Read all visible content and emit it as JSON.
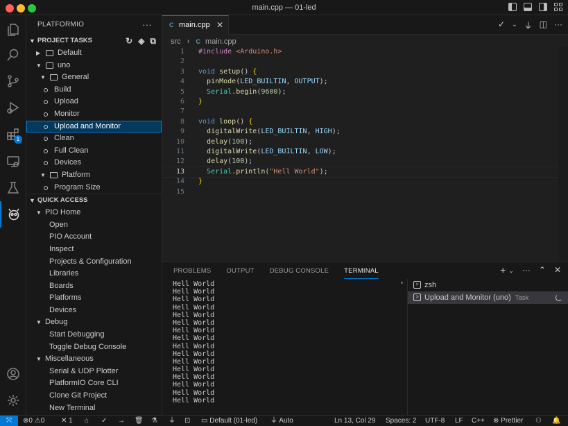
{
  "window": {
    "title": "main.cpp — 01-led"
  },
  "activity_bar": {
    "extensions_badge": "1",
    "items": [
      "explorer-icon",
      "search-icon",
      "source-control-icon",
      "run-debug-icon",
      "extensions-icon",
      "remote-explorer-icon",
      "testing-icon",
      "platformio-icon",
      "accounts-icon",
      "manage-gear-icon"
    ]
  },
  "sidebar": {
    "title": "PLATFORMIO",
    "more": "···",
    "project_tasks": {
      "header": "PROJECT TASKS",
      "items": [
        {
          "label": "Default"
        },
        {
          "label": "uno"
        },
        {
          "label": "General"
        },
        {
          "label": "Build"
        },
        {
          "label": "Upload"
        },
        {
          "label": "Monitor"
        },
        {
          "label": "Upload and Monitor"
        },
        {
          "label": "Clean"
        },
        {
          "label": "Full Clean"
        },
        {
          "label": "Devices"
        },
        {
          "label": "Platform"
        },
        {
          "label": "Program Size"
        }
      ]
    },
    "quick_access": {
      "header": "QUICK ACCESS",
      "items": [
        {
          "label": "PIO Home"
        },
        {
          "label": "Open"
        },
        {
          "label": "PIO Account"
        },
        {
          "label": "Inspect"
        },
        {
          "label": "Projects & Configuration"
        },
        {
          "label": "Libraries"
        },
        {
          "label": "Boards"
        },
        {
          "label": "Platforms"
        },
        {
          "label": "Devices"
        },
        {
          "label": "Debug"
        },
        {
          "label": "Start Debugging"
        },
        {
          "label": "Toggle Debug Console"
        },
        {
          "label": "Miscellaneous"
        },
        {
          "label": "Serial & UDP Plotter"
        },
        {
          "label": "PlatformIO Core CLI"
        },
        {
          "label": "Clone Git Project"
        },
        {
          "label": "New Terminal"
        }
      ]
    }
  },
  "editor": {
    "tab": {
      "label": "main.cpp",
      "lang_icon": "C"
    },
    "breadcrumb": {
      "folder": "src",
      "file": "main.cpp"
    },
    "current_line": 13,
    "lines": [
      "#include <Arduino.h>",
      "",
      "void setup() {",
      "  pinMode(LED_BUILTIN, OUTPUT);",
      "  Serial.begin(9600);",
      "}",
      "",
      "void loop() {",
      "  digitalWrite(LED_BUILTIN, HIGH);",
      "  delay(100);",
      "  digitalWrite(LED_BUILTIN, LOW);",
      "  delay(100);",
      "  Serial.println(\"Hell World\");",
      "}",
      ""
    ]
  },
  "panel": {
    "tabs": [
      "PROBLEMS",
      "OUTPUT",
      "DEBUG CONSOLE",
      "TERMINAL"
    ],
    "active_tab": "TERMINAL",
    "terminal_output": [
      "Hell World",
      "Hell World",
      "Hell World",
      "Hell World",
      "Hell World",
      "Hell World",
      "Hell World",
      "Hell World",
      "Hell World",
      "Hell World",
      "Hell World",
      "Hell World",
      "Hell World",
      "Hell World",
      "Hell World",
      "Hell World"
    ],
    "terminals": [
      {
        "label": "zsh",
        "tag": ""
      },
      {
        "label": "Upload and Monitor (uno)",
        "tag": "Task"
      }
    ]
  },
  "statusbar": {
    "errors": "0",
    "warnings": "0",
    "tools": "1",
    "env": "Default (01-led)",
    "port": "Auto",
    "position": "Ln 13, Col 29",
    "spaces": "Spaces: 2",
    "encoding": "UTF-8",
    "eol": "LF",
    "language": "C++",
    "formatter": "Prettier"
  },
  "colors": {
    "accent": "#0078d4",
    "background": "#1f1f1f",
    "sidebar": "#181818"
  }
}
